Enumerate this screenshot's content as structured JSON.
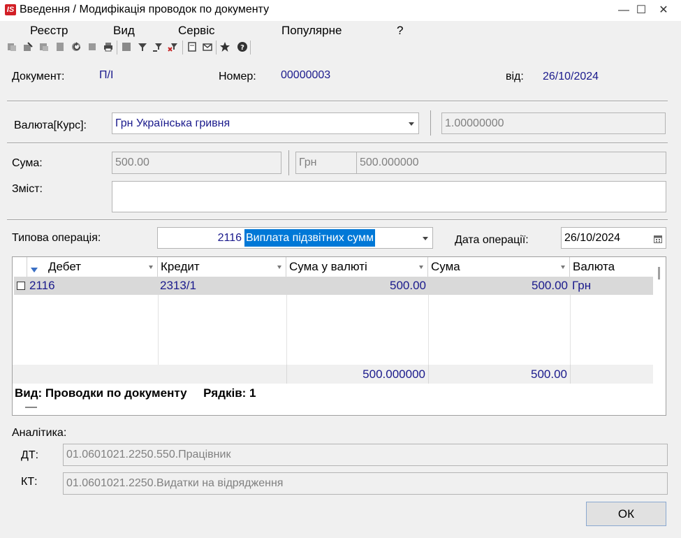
{
  "window": {
    "title": "Введення / Модифікація проводок по документу",
    "logo_text": "IS",
    "controls": {
      "minimize": "—",
      "maximize": "☐",
      "close": "✕"
    }
  },
  "menu": {
    "items": [
      "Реєстр",
      "Вид",
      "Сервіс",
      "Популярне",
      "?"
    ]
  },
  "toolbar": {
    "icons": [
      "copy-icon",
      "edit-icon",
      "copy-row-icon",
      "paste-icon",
      "delete-icon",
      "refresh-icon",
      "undo-icon",
      "print-icon",
      "stop-icon",
      "filter-icon",
      "filter-clear-icon",
      "filter-remove-icon",
      "document-icon",
      "mail-icon",
      "star-icon",
      "help-icon"
    ]
  },
  "document": {
    "doc_label": "Документ:",
    "doc_value": "П/І",
    "number_label": "Номер:",
    "number_value": "00000003",
    "date_label": "від:",
    "date_value": "26/10/2024"
  },
  "currency": {
    "label": "Валюта[Курс]:",
    "value": "Грн Українська гривня",
    "rate": "1.00000000"
  },
  "amount": {
    "label": "Сума:",
    "value": "500.00",
    "currency_code": "Грн",
    "converted": "500.000000"
  },
  "content": {
    "label": "Зміст:",
    "value": ""
  },
  "operation": {
    "label": "Типова операція:",
    "code": "2116",
    "name": "Виплата підзвітних сумм",
    "date_label": "Дата операції:",
    "date_value": "26/10/2024"
  },
  "grid": {
    "columns": [
      "Дебет",
      "Кредит",
      "Сума у валюті",
      "Сума",
      "Валюта"
    ],
    "rows": [
      {
        "debit": "2116",
        "credit": "2313/1",
        "amount_currency": "500.00",
        "amount": "500.00",
        "currency": "Грн"
      }
    ],
    "totals": {
      "amount_currency": "500.000000",
      "amount": "500.00"
    },
    "status": "Вид: Проводки по документу     Рядків: 1"
  },
  "analytics": {
    "label": "Аналітика:",
    "dt_label": "ДТ:",
    "dt_value": "01.0601021.2250.550.Працівник",
    "kt_label": "КТ:",
    "kt_value": "01.0601021.2250.Видатки на відрядження"
  },
  "buttons": {
    "ok": "ОК"
  },
  "colors": {
    "value_text": "#1a1a8c",
    "selection": "#0078d7",
    "logo": "#d21f26"
  }
}
